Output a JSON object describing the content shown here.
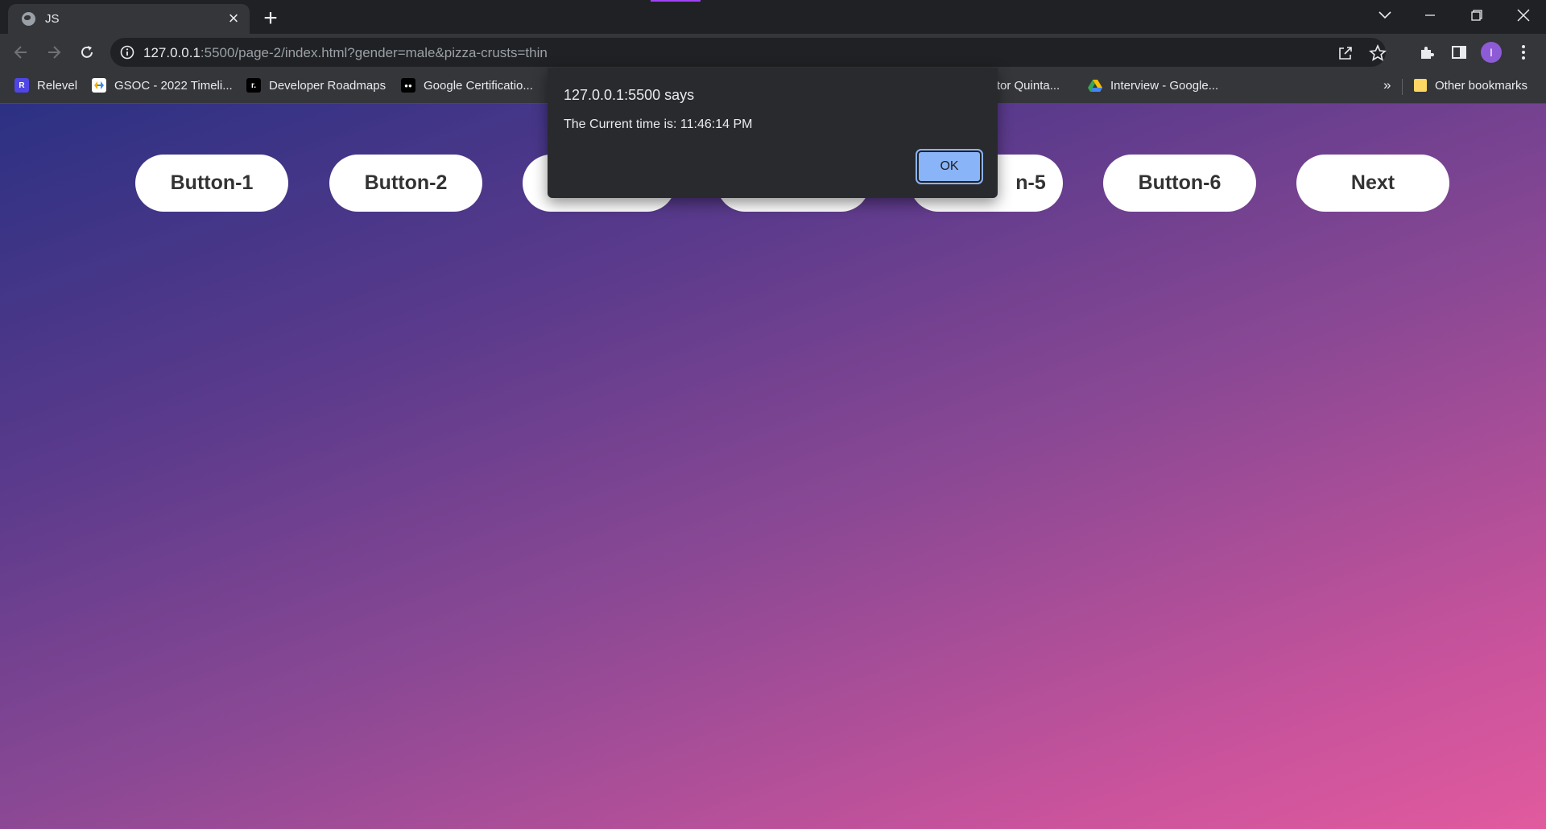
{
  "browser": {
    "tab": {
      "title": "JS"
    },
    "address_bar": {
      "host": "127.0.0.1",
      "path": ":5500/page-2/index.html?gender=male&pizza-crusts=thin"
    },
    "bookmarks": [
      {
        "label": "Relevel",
        "icon": "relevel-icon",
        "icon_text": "R",
        "color": "#4f46e5"
      },
      {
        "label": "GSOC - 2022 Timeli...",
        "icon": "gsoc-icon",
        "icon_text": "",
        "color": "#ffffff"
      },
      {
        "label": "Developer Roadmaps",
        "icon": "roadmap-icon",
        "icon_text": "r.",
        "color": "#000000"
      },
      {
        "label": "Google Certificatio...",
        "icon": "medium-icon",
        "icon_text": "●●",
        "color": "#000000"
      },
      {
        "label": "ector Quinta...",
        "icon": "",
        "icon_text": "",
        "color": ""
      },
      {
        "label": "Interview - Google...",
        "icon": "google-drive-icon",
        "icon_text": "",
        "color": "#34a853"
      }
    ],
    "bookmarks_overflow": "»",
    "other_bookmarks": "Other bookmarks",
    "profile_initial": "I"
  },
  "page": {
    "buttons": [
      "Button-1",
      "Button-2",
      "",
      "",
      "n-5",
      "Button-6",
      "Next"
    ]
  },
  "dialog": {
    "title": "127.0.0.1:5500 says",
    "message": "The Current time is: 11:46:14 PM",
    "ok_label": "OK"
  },
  "colors": {
    "gradient_start": "#2c3183",
    "gradient_end": "#e15a9e",
    "dialog_bg": "#292a2d",
    "ok_button": "#8ab4f8"
  }
}
